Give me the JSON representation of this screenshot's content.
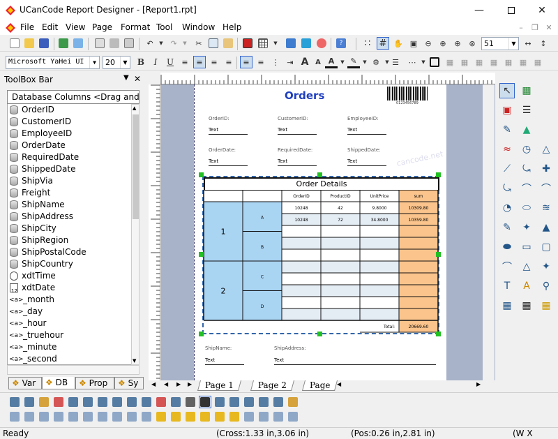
{
  "window": {
    "title": "UCanCode Report Designer - [Report1.rpt]"
  },
  "menu": [
    "File",
    "Edit",
    "View",
    "Page",
    "Format",
    "Tool",
    "Window",
    "Help"
  ],
  "format_toolbar": {
    "font": "Microsoft YaHei UI",
    "size": "20",
    "bold": "B",
    "italic": "I",
    "underline": "U"
  },
  "zoom": "51",
  "toolbox": {
    "title": "ToolBox Bar",
    "header": "Database Columns <Drag and",
    "fields": [
      {
        "label": "OrderID",
        "icon": "database-icon"
      },
      {
        "label": "CustomerID",
        "icon": "database-icon"
      },
      {
        "label": "EmployeeID",
        "icon": "database-icon"
      },
      {
        "label": "OrderDate",
        "icon": "database-icon"
      },
      {
        "label": "RequiredDate",
        "icon": "database-icon"
      },
      {
        "label": "ShippedDate",
        "icon": "database-icon"
      },
      {
        "label": "ShipVia",
        "icon": "database-icon"
      },
      {
        "label": "Freight",
        "icon": "database-icon"
      },
      {
        "label": "ShipName",
        "icon": "database-icon"
      },
      {
        "label": "ShipAddress",
        "icon": "database-icon"
      },
      {
        "label": "ShipCity",
        "icon": "database-icon"
      },
      {
        "label": "ShipRegion",
        "icon": "database-icon"
      },
      {
        "label": "ShipPostalCode",
        "icon": "database-icon"
      },
      {
        "label": "ShipCountry",
        "icon": "database-icon"
      },
      {
        "label": "xdtTime",
        "icon": "clock-icon"
      },
      {
        "label": "xdtDate",
        "icon": "calendar-icon"
      },
      {
        "label": "_month",
        "icon": "variable-icon"
      },
      {
        "label": "_day",
        "icon": "variable-icon"
      },
      {
        "label": "_hour",
        "icon": "variable-icon"
      },
      {
        "label": "_truehour",
        "icon": "variable-icon"
      },
      {
        "label": "_minute",
        "icon": "variable-icon"
      },
      {
        "label": "_second",
        "icon": "variable-icon"
      }
    ],
    "tabs": [
      "Var",
      "DB",
      "Prop",
      "Sy"
    ],
    "active_tab": "DB"
  },
  "report": {
    "title": "Orders",
    "barcode_text": "0123456789",
    "watermark": "cancode.net",
    "fields": [
      {
        "label": "OrderID:",
        "value": "Text"
      },
      {
        "label": "CustomerID:",
        "value": "Text"
      },
      {
        "label": "EmployeeID:",
        "value": "Text"
      },
      {
        "label": "OrderDate:",
        "value": "Text"
      },
      {
        "label": "RequiredDate:",
        "value": "Text"
      },
      {
        "label": "ShippedDate:",
        "value": "Text"
      }
    ],
    "footer_fields": [
      {
        "label": "ShipName:",
        "value": "Text"
      },
      {
        "label": "ShipAddress:",
        "value": "Text"
      }
    ],
    "table": {
      "title": "Order Details",
      "columns": [
        "OrderID",
        "ProductID",
        "UnitPrice",
        "sum"
      ],
      "groups": [
        "1",
        "2"
      ],
      "subgroups": [
        "A",
        "B",
        "C",
        "D"
      ],
      "rows": [
        [
          "10248",
          "42",
          "9.8000",
          "10309.80"
        ],
        [
          "10248",
          "72",
          "34.8000",
          "10359.80"
        ]
      ],
      "total_label": "Total:",
      "total_value": "20669.60"
    }
  },
  "pages": [
    "Page 1",
    "Page 2",
    "Page"
  ],
  "status": {
    "ready": "Ready",
    "cross": "(Cross:1.33 in,3.06 in)",
    "pos": "(Pos:0.26 in,2.81 in)",
    "size": "(W X"
  },
  "colors": {
    "accent": "#1f3fbf",
    "sum_col": "#fac48c",
    "group_col": "#a9d4f2",
    "grid": "#e4ecf4",
    "handle": "#22c022"
  }
}
